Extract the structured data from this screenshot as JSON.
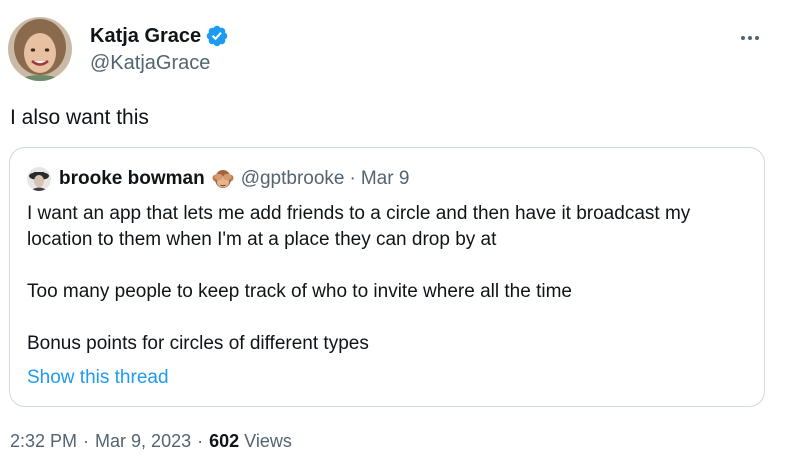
{
  "tweet": {
    "author": {
      "name": "Katja Grace",
      "handle": "@KatjaGrace",
      "verified_icon": "verified-badge-icon",
      "avatar_icon": "user-avatar"
    },
    "more_icon": "more-horizontal-icon",
    "text": "I also want this",
    "quote": {
      "author_name": "brooke bowman",
      "emoji_icon": "see-no-evil-monkey-icon",
      "handle": "@gptbrooke",
      "separator": "·",
      "date": "Mar 9",
      "paragraphs": [
        "I want an app that lets me add friends to a circle and then have it broadcast my location to them when I'm at a place they can drop by at",
        "Too many people to keep track of who to invite where all the time",
        "Bonus points for circles of different types"
      ],
      "show_thread": "Show this thread"
    },
    "meta": {
      "time": "2:32 PM",
      "separator1": "·",
      "date": "Mar 9, 2023",
      "separator2": "·",
      "views_count": "602",
      "views_label": "Views"
    },
    "colors": {
      "link": "#1d9bf0",
      "secondary_text": "#536471",
      "border": "#cfd9de",
      "verified": "#1d9bf0"
    }
  }
}
